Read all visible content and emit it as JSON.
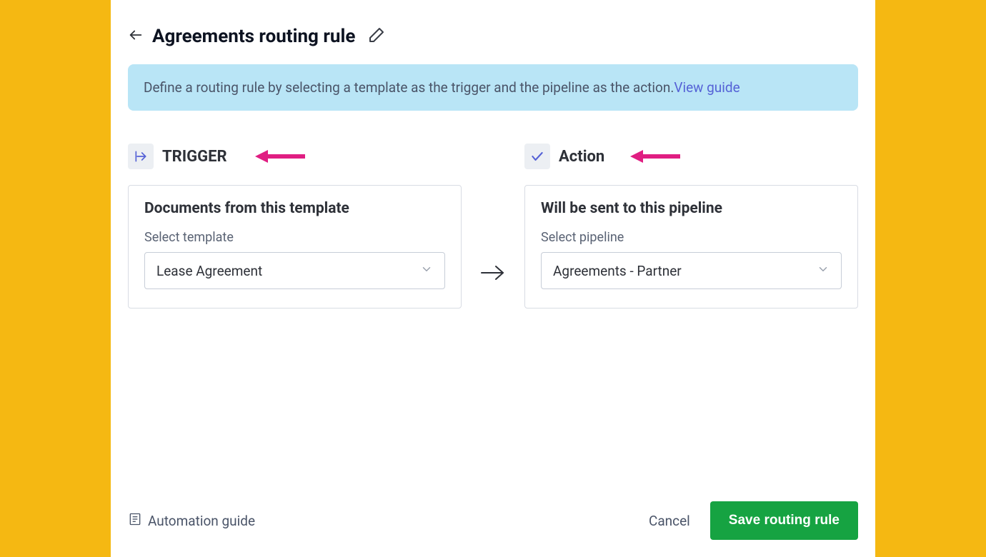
{
  "header": {
    "title": "Agreements routing rule"
  },
  "banner": {
    "text": "Define a routing rule by selecting a template as the trigger and the pipeline as the action.",
    "link_text": "View guide"
  },
  "trigger": {
    "label": "TRIGGER",
    "card_title": "Documents from this template",
    "field_label": "Select template",
    "selected_value": "Lease Agreement"
  },
  "action": {
    "label": "Action",
    "card_title": "Will be sent to this pipeline",
    "field_label": "Select pipeline",
    "selected_value": "Agreements - Partner"
  },
  "footer": {
    "guide_label": "Automation guide",
    "cancel_label": "Cancel",
    "save_label": "Save routing rule"
  },
  "colors": {
    "page_frame": "#f5b812",
    "banner_bg": "#b9e5f6",
    "link": "#5562d6",
    "save_button": "#16a342",
    "pointer_arrow": "#e01e82"
  }
}
